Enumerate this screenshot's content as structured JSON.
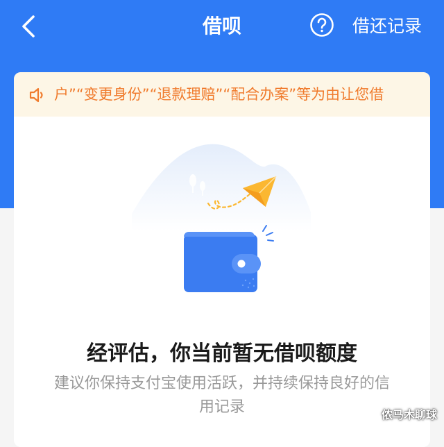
{
  "header": {
    "title": "借呗",
    "records_label": "借还记录",
    "back_icon": "chevron-left-icon",
    "help_icon": "question-circle-icon"
  },
  "notice": {
    "icon": "speaker-icon",
    "text": "户”“变更身份”“退款理赔”“配合办案”等为由让您借"
  },
  "status": {
    "title": "经评估，你当前暂无借呗额度",
    "description": "建议你保持支付宝使用活跃，并持续保持良好的信用记录"
  },
  "watermark": "侬马木聊球",
  "colors": {
    "brand_blue": "#2f7bf5",
    "notice_bg": "#fdf6e6",
    "notice_text": "#f07b2d",
    "plane_yellow": "#fbb731",
    "wallet_blue": "#3b7cf1"
  }
}
